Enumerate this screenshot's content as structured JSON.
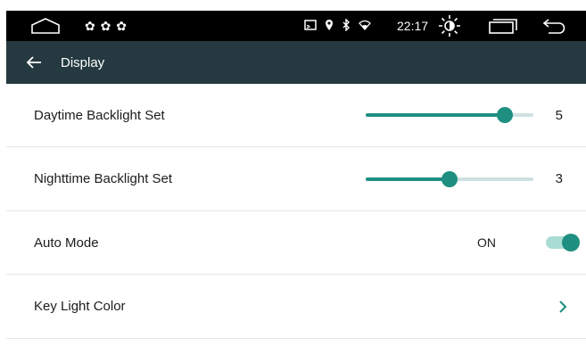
{
  "status_bar": {
    "notification_icons": "✿ ✿ ✿",
    "time": "22:17",
    "icons": [
      "home-icon",
      "notification-icons",
      "cast-icon",
      "location-icon",
      "bluetooth-icon",
      "wifi-icon",
      "brightness-icon",
      "recents-icon",
      "back-icon"
    ]
  },
  "title_bar": {
    "title": "Display",
    "back_icon": "arrow-left-icon"
  },
  "settings": {
    "daytime": {
      "label": "Daytime Backlight Set",
      "value": "5",
      "level": 0.83
    },
    "nighttime": {
      "label": "Nighttime Backlight Set",
      "value": "3",
      "level": 0.5
    },
    "auto_mode": {
      "label": "Auto Mode",
      "state": "ON",
      "on": true
    },
    "key_light": {
      "label": "Key Light Color",
      "icon": "chevron-right-icon"
    }
  },
  "colors": {
    "accent": "#1e8f80",
    "title_bar_bg": "#253a40",
    "status_bar_bg": "#000000"
  }
}
